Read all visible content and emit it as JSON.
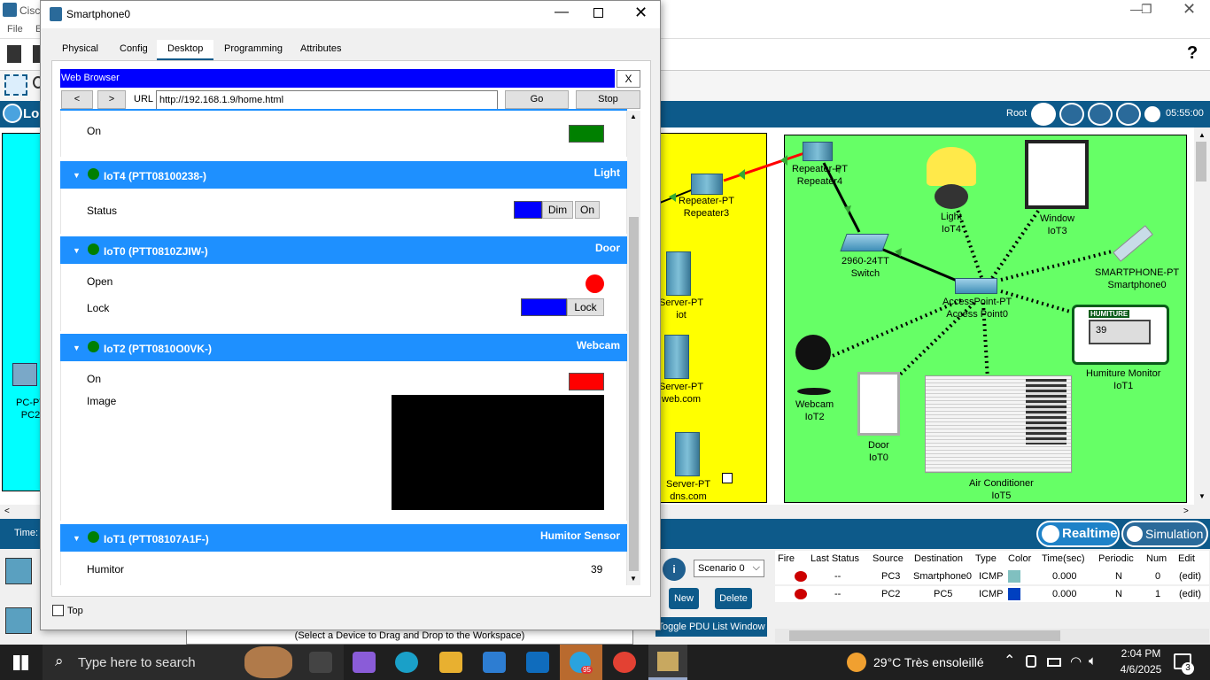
{
  "app": {
    "title_fragment": "Cisc",
    "menu_file": "File",
    "menu_e": "E",
    "help": "?",
    "root_label": "Root",
    "clock": "05:55:00",
    "time_label": "Time:",
    "logical_fragment": "Lo"
  },
  "workspace": {
    "devices": [
      {
        "id": "repeater3",
        "line1": "Repeater-PT",
        "line2": "Repeater3"
      },
      {
        "id": "repeater4",
        "line1": "Repeater-PT",
        "line2": "Repeater4"
      },
      {
        "id": "server-iot",
        "line1": "Server-PT",
        "line2": "iot"
      },
      {
        "id": "server-web",
        "line1": "Server-PT",
        "line2": "web.com"
      },
      {
        "id": "server-dns",
        "line1": "Server-PT",
        "line2": "dns.com"
      },
      {
        "id": "switch",
        "line1": "2960-24TT",
        "line2": "Switch"
      },
      {
        "id": "light",
        "line1": "Light",
        "line2": "IoT4"
      },
      {
        "id": "window",
        "line1": "Window",
        "line2": "IoT3"
      },
      {
        "id": "smartphone",
        "line1": "SMARTPHONE-PT",
        "line2": "Smartphone0"
      },
      {
        "id": "accesspoint",
        "line1": "AccessPoint-PT",
        "line2": "Access Point0"
      },
      {
        "id": "humiture",
        "line1": "Humiture Monitor",
        "line2": "IoT1"
      },
      {
        "id": "webcam",
        "line1": "Webcam",
        "line2": "IoT2"
      },
      {
        "id": "door",
        "line1": "Door",
        "line2": "IoT0"
      },
      {
        "id": "aircon",
        "line1": "Air Conditioner",
        "line2": "IoT5"
      },
      {
        "id": "pc2",
        "line1": "PC-PT",
        "line2": "PC2"
      }
    ],
    "humiture_badge": "HUMITURE",
    "humiture_value": "39"
  },
  "bottom": {
    "realtime": "Realtime",
    "simulation": "Simulation",
    "scenario": "Scenario 0",
    "new_btn": "New",
    "delete_btn": "Delete",
    "toggle_pdu": "Toggle PDU List Window",
    "drag_hint": "(Select a Device to Drag and Drop to the Workspace)",
    "pdu_headers": [
      "Fire",
      "Last Status",
      "Source",
      "Destination",
      "Type",
      "Color",
      "Time(sec)",
      "Periodic",
      "Num",
      "Edit"
    ],
    "pdu_rows": [
      {
        "last": "--",
        "source": "PC3",
        "dest": "Smartphone0",
        "type": "ICMP",
        "color": "#80c0c0",
        "time": "0.000",
        "periodic": "N",
        "num": "0",
        "edit": "(edit)"
      },
      {
        "last": "--",
        "source": "PC2",
        "dest": "PC5",
        "type": "ICMP",
        "color": "#0040c0",
        "time": "0.000",
        "periodic": "N",
        "num": "1",
        "edit": "(edit)"
      }
    ]
  },
  "dialog": {
    "title": "Smartphone0",
    "tabs": [
      "Physical",
      "Config",
      "Desktop",
      "Programming",
      "Attributes"
    ],
    "active_tab": "Desktop",
    "web_browser_title": "Web Browser",
    "close_x": "X",
    "back": "<",
    "forward": ">",
    "url_label": "URL",
    "url": "http://192.168.1.9/home.html",
    "go": "Go",
    "stop": "Stop",
    "top_checkbox": "Top",
    "partial_on_label": "On",
    "sections": [
      {
        "name": "IoT4 (PTT08100238-)",
        "type": "Light",
        "status_label": "Status",
        "btn_dim": "Dim",
        "btn_on": "On"
      },
      {
        "name": "IoT0 (PTT0810ZJIW-)",
        "type": "Door",
        "open_label": "Open",
        "lock_label": "Lock",
        "btn_lock": "Lock"
      },
      {
        "name": "IoT2 (PTT0810O0VK-)",
        "type": "Webcam",
        "on_label": "On",
        "image_label": "Image"
      },
      {
        "name": "IoT1 (PTT08107A1F-)",
        "type": "Humitor Sensor",
        "humitor_label": "Humitor",
        "humitor_value": "39"
      }
    ],
    "colors": {
      "on_green": "#008000",
      "on_red": "#ff0000",
      "status_blue": "#0000ff",
      "header_blue": "#1e90ff",
      "lock_blue": "#0000ff"
    }
  },
  "taskbar": {
    "search": "Type here to search",
    "weather": "29°C  Très ensoleillé",
    "time": "2:04 PM",
    "date": "4/6/2025",
    "notif_count": "3",
    "telegram_badge": "95"
  }
}
